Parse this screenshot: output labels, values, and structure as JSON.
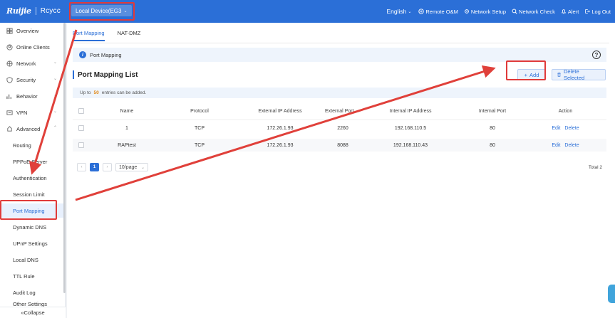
{
  "header": {
    "brand": "Ruijie",
    "product": "Rcycc",
    "device_select": "Local Device(EG3",
    "language": "English",
    "remote_om": "Remote O&M",
    "network_setup": "Network Setup",
    "network_check": "Network Check",
    "alert": "Alert",
    "logout": "Log Out",
    "color": "#2b6fd7"
  },
  "sidebar": {
    "items": [
      {
        "label": "Overview",
        "icon": "overview-icon"
      },
      {
        "label": "Online Clients",
        "icon": "clients-icon"
      },
      {
        "label": "Network",
        "icon": "network-icon"
      },
      {
        "label": "Security",
        "icon": "security-icon"
      },
      {
        "label": "Behavior",
        "icon": "behavior-icon"
      },
      {
        "label": "VPN",
        "icon": "vpn-icon"
      },
      {
        "label": "Advanced",
        "icon": "advanced-icon"
      },
      {
        "label": "Routing"
      },
      {
        "label": "PPPoE Server"
      },
      {
        "label": "Authentication"
      },
      {
        "label": "Session Limit"
      },
      {
        "label": "Port Mapping",
        "active": true
      },
      {
        "label": "Dynamic DNS"
      },
      {
        "label": "UPnP Settings"
      },
      {
        "label": "Local DNS"
      },
      {
        "label": "TTL Rule"
      },
      {
        "label": "Audit Log"
      },
      {
        "label": "Other Settings"
      }
    ],
    "collapse": "Collapse"
  },
  "main": {
    "tabs": [
      {
        "label": "Port Mapping",
        "active": true
      },
      {
        "label": "NAT-DMZ"
      }
    ],
    "info_title": "Port Mapping",
    "list_title": "Port Mapping List",
    "add_button": "Add",
    "delete_button": "Delete Selected",
    "limit": {
      "prefix": "Up to",
      "count": "50",
      "suffix": "entries can be added."
    },
    "table": {
      "headers": [
        "Name",
        "Protocol",
        "External IP Address",
        "External Port",
        "Internal IP Address",
        "Internal Port",
        "Action"
      ],
      "rows": [
        {
          "name": "1",
          "protocol": "TCP",
          "ext_ip": "172.26.1.93",
          "ext_port": "2260",
          "int_ip": "192.168.110.5",
          "int_port": "80",
          "edit": "Edit",
          "delete": "Delete"
        },
        {
          "name": "RAPtest",
          "protocol": "TCP",
          "ext_ip": "172.26.1.93",
          "ext_port": "8088",
          "int_ip": "192.168.110.43",
          "int_port": "80",
          "edit": "Edit",
          "delete": "Delete"
        }
      ]
    },
    "pager": {
      "current": "1",
      "page_size": "10/page",
      "total": "Total 2"
    }
  }
}
